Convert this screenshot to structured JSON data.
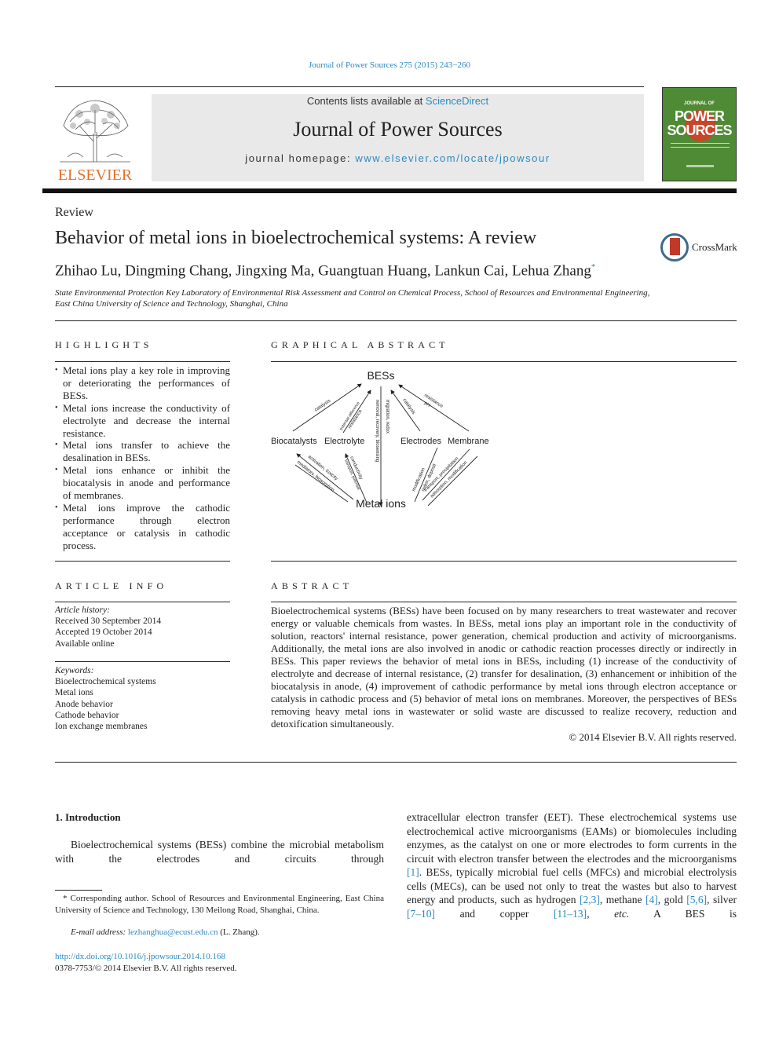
{
  "running_head": "Journal of Power Sources 275 (2015) 243−260",
  "masthead": {
    "contents_prefix": "Contents lists available at ",
    "contents_link": "ScienceDirect",
    "journal_title": "Journal of Power Sources",
    "homepage_prefix": "journal homepage: ",
    "homepage_link": "www.elsevier.com/locate/jpowsour"
  },
  "publisher_logo": "ELSEVIER",
  "cover": {
    "line1": "JOURNAL OF",
    "line2": "POWER",
    "line3": "SOURCES",
    "bg_color": "#4f8a34",
    "accent_color": "#c8452a"
  },
  "crossmark_label": "CrossMark",
  "article": {
    "type": "Review",
    "title": "Behavior of metal ions in bioelectrochemical systems: A review",
    "authors": "Zhihao Lu, Dingming Chang, Jingxing Ma, Guangtuan Huang, Lankun Cai, Lehua Zhang",
    "corresponding_mark": "*",
    "affiliation": "State Environmental Protection Key Laboratory of Environmental Risk Assessment and Control on Chemical Process, School of Resources and Environmental Engineering, East China University of Science and Technology, Shanghai, China"
  },
  "highlights": {
    "heading": "HIGHLIGHTS",
    "items": [
      "Metal ions play a key role in improving or deteriorating the performances of BESs.",
      "Metal ions increase the conductivity of electrolyte and decrease the internal resistance.",
      "Metal ions transfer to achieve the desalination in BESs.",
      "Metal ions enhance or inhibit the biocatalysis in anode and performance of membranes.",
      "Metal ions improve the cathodic performance through electron acceptance or catalysis in cathodic process."
    ]
  },
  "graphical_abstract": {
    "heading": "GRAPHICAL ABSTRACT",
    "nodes": {
      "top": "BESs",
      "bottom": "Metal ions",
      "biocatalysts": "Biocatalysts",
      "electrolyte": "Electrolyte",
      "electrodes": "Electrodes",
      "membrane": "Membrane"
    },
    "edge_labels": {
      "bio_top": "catalysis",
      "elec_top_1": "potential difference",
      "elec_top_2": "resistance",
      "center_1": "removal, recovery, biosensing",
      "center_2": "migration, redox",
      "electrodes_top": "catalysis",
      "membrane_top_1": "resistance",
      "membrane_top_2": "pH",
      "bio_bottom_1": "activation, toxicity",
      "bio_bottom_2": "mediators, biosorption",
      "elec_bottom_1": "conductivity",
      "elec_bottom_2": "transport, potential",
      "electrodes_bottom_1": "modification",
      "electrodes_bottom_2": "redox, deposit",
      "membrane_bottom_1": "transport, precipitation",
      "membrane_bottom_2": "adsorption, modification"
    }
  },
  "article_info": {
    "heading": "ARTICLE INFO",
    "history_label": "Article history:",
    "history": [
      "Received 30 September 2014",
      "Accepted 19 October 2014",
      "Available online"
    ],
    "keywords_label": "Keywords:",
    "keywords": [
      "Bioelectrochemical systems",
      "Metal ions",
      "Anode behavior",
      "Cathode behavior",
      "Ion exchange membranes"
    ]
  },
  "abstract": {
    "heading": "ABSTRACT",
    "text": "Bioelectrochemical systems (BESs) have been focused on by many researchers to treat wastewater and recover energy or valuable chemicals from wastes. In BESs, metal ions play an important role in the conductivity of solution, reactors' internal resistance, power generation, chemical production and activity of microorganisms. Additionally, the metal ions are also involved in anodic or cathodic reaction processes directly or indirectly in BESs. This paper reviews the behavior of metal ions in BESs, including (1) increase of the conductivity of electrolyte and decrease of internal resistance, (2) transfer for desalination, (3) enhancement or inhibition of the biocatalysis in anode, (4) improvement of cathodic performance by metal ions through electron acceptance or catalysis in cathodic process and (5) behavior of metal ions on membranes. Moreover, the perspectives of BESs removing heavy metal ions in wastewater or solid waste are discussed to realize recovery, reduction and detoxification simultaneously.",
    "copyright": "© 2014 Elsevier B.V. All rights reserved."
  },
  "intro": {
    "heading": "1.  Introduction",
    "para1": "Bioelectrochemical systems (BESs) combine the microbial metabolism with the electrodes and circuits through",
    "col2_parts": [
      {
        "t": "extracellular electron transfer (EET). These electrochemical systems use electrochemical active microorganisms (EAMs) or biomolecules including enzymes, as the catalyst on one or more electrodes to form currents in the circuit with electron transfer between the electrodes and the microorganisms "
      },
      {
        "r": "[1]"
      },
      {
        "t": ". BESs, typically microbial fuel cells (MFCs) and microbial electrolysis cells (MECs), can be used not only to treat the wastes but also to harvest energy and products, such as hydrogen "
      },
      {
        "r": "[2,3]"
      },
      {
        "t": ", methane "
      },
      {
        "r": "[4]"
      },
      {
        "t": ", gold "
      },
      {
        "r": "[5,6]"
      },
      {
        "t": ", silver "
      },
      {
        "r": "[7–10]"
      },
      {
        "t": " and copper "
      },
      {
        "r": "[11–13]"
      },
      {
        "t": ", "
      },
      {
        "i": "etc."
      },
      {
        "t": " A BES is"
      }
    ]
  },
  "footnote": {
    "corresponding": "* Corresponding author. School of Resources and Environmental Engineering, East China University of Science and Technology, 130 Meilong Road, Shanghai, China.",
    "email_label": "E-mail address:",
    "email": "lezhanghua@ecust.edu.cn",
    "email_suffix": " (L. Zhang).",
    "doi": "http://dx.doi.org/10.1016/j.jpowsour.2014.10.168",
    "issn": "0378-7753/© 2014 Elsevier B.V. All rights reserved."
  },
  "link_color": "#2a8ac0",
  "elsevier_color": "#e5712b"
}
